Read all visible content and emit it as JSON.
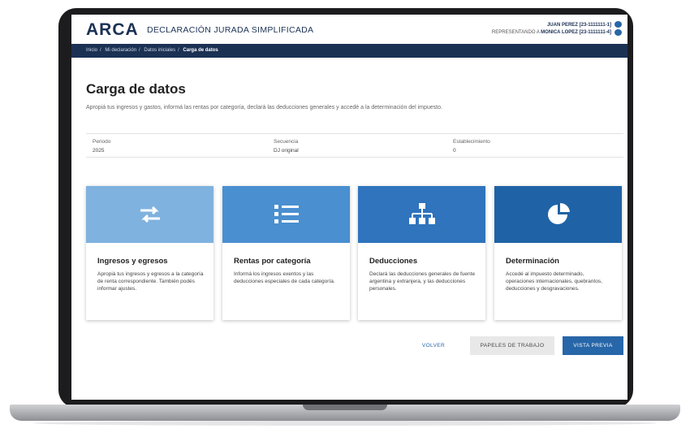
{
  "header": {
    "logo": "ARCA",
    "title": "DECLARACIÓN JURADA SIMPLIFICADA",
    "user_line1": "JUAN PEREZ [23-1111111-1]",
    "user_line2_prefix": "REPRESENTANDO A",
    "user_line2_name": "MONICA LOPEZ [23-1111111-4]"
  },
  "breadcrumb": [
    "Inicio",
    "Mi declaración",
    "Datos iniciales",
    "Carga de datos"
  ],
  "page": {
    "title": "Carga de datos",
    "description": "Apropiá tus ingresos y gastos, informá las rentas por categoría, declará las deducciones generales y accedé a la determinación del impuesto."
  },
  "info": [
    {
      "label": "Periodo",
      "value": "2025"
    },
    {
      "label": "Secuencia",
      "value": "DJ original"
    },
    {
      "label": "Establecimiento",
      "value": "0"
    }
  ],
  "cards": [
    {
      "title": "Ingresos y egresos",
      "text": "Apropiá tus ingresos y egresos a la categoría de renta correspondiente. También podés informar ajustes.",
      "color": "#7fb2df",
      "icon": "swap-arrows-icon"
    },
    {
      "title": "Rentas por categoría",
      "text": "Informá los ingresos exentos y las deducciones especiales de cada categoría.",
      "color": "#4a8fd0",
      "icon": "list-icon"
    },
    {
      "title": "Deducciones",
      "text": "Declará las deducciones generales de fuente argentina y extranjera, y las deducciones personales.",
      "color": "#2f74bd",
      "icon": "sitemap-icon"
    },
    {
      "title": "Determinación",
      "text": "Accedé al impuesto determinado, operaciones internacionales, quebrantos, deducciones y desgravaciones.",
      "color": "#1f63a6",
      "icon": "pie-chart-icon"
    }
  ],
  "buttons": {
    "volver": "VOLVER",
    "papeles": "PAPELES DE TRABAJO",
    "vista": "VISTA PREVIA"
  }
}
